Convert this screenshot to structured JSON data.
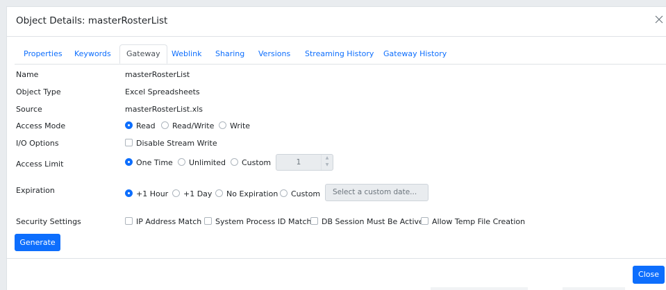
{
  "modal": {
    "title": "Object Details: masterRosterList"
  },
  "tabs": [
    {
      "label": "Properties",
      "active": false
    },
    {
      "label": "Keywords",
      "active": false
    },
    {
      "label": "Gateway",
      "active": true
    },
    {
      "label": "Weblink",
      "active": false
    },
    {
      "label": "Sharing",
      "active": false
    },
    {
      "label": "Versions",
      "active": false
    },
    {
      "label": "Streaming History",
      "active": false
    },
    {
      "label": "Gateway History",
      "active": false
    }
  ],
  "fields": {
    "name": {
      "label": "Name",
      "value": "masterRosterList"
    },
    "object_type": {
      "label": "Object Type",
      "value": "Excel Spreadsheets"
    },
    "source": {
      "label": "Source",
      "value": "masterRosterList.xls"
    },
    "access_mode": {
      "label": "Access Mode",
      "options": [
        "Read",
        "Read/Write",
        "Write"
      ],
      "selected": "Read"
    },
    "io_options": {
      "label": "I/O Options",
      "options": [
        "Disable Stream Write"
      ]
    },
    "access_limit": {
      "label": "Access Limit",
      "options": [
        "One Time",
        "Unlimited",
        "Custom"
      ],
      "selected": "One Time",
      "custom_value": "1"
    },
    "expiration": {
      "label": "Expiration",
      "options": [
        "+1 Hour",
        "+1 Day",
        "No Expiration",
        "Custom"
      ],
      "selected": "+1 Hour",
      "date_placeholder": "Select a custom date..."
    },
    "security": {
      "label": "Security Settings",
      "options": [
        "IP Address Match",
        "System Process ID Match",
        "DB Session Must Be Active",
        "Allow Temp File Creation"
      ]
    }
  },
  "buttons": {
    "generate": "Generate",
    "close": "Close"
  },
  "colors": {
    "primary": "#0d6efd",
    "border": "#dee2e6",
    "disabled_bg": "#e9ecef"
  }
}
